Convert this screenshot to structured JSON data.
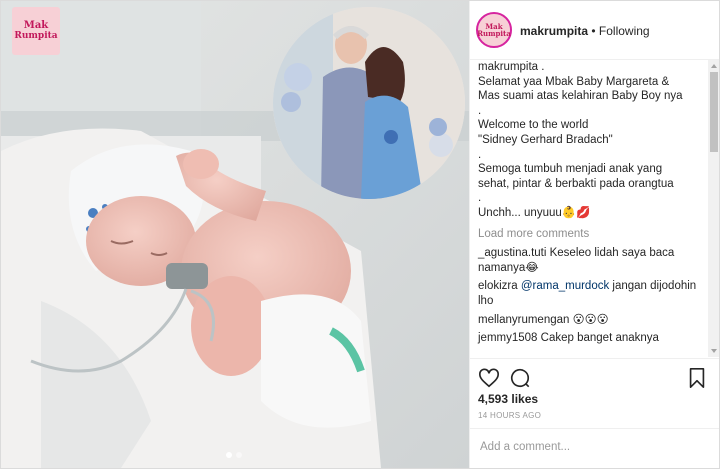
{
  "logo": {
    "line1": "Mak",
    "line2": "Rumpita"
  },
  "header": {
    "avatar": {
      "line1": "Mak",
      "line2": "Rumpita"
    },
    "username": "makrumpita",
    "separator": " • ",
    "follow_status": "Following"
  },
  "caption": {
    "username": "makrumpita .",
    "lines": [
      "Selamat yaa Mbak Baby Margareta &",
      "Mas suami atas kelahiran Baby Boy nya",
      ".",
      "Welcome to the world",
      "\"Sidney Gerhard Bradach\"",
      ".",
      "Semoga tumbuh menjadi anak yang",
      "sehat, pintar & berbakti pada orangtua",
      ".",
      "Unchh... unyuuu👶💋"
    ]
  },
  "load_more": "Load more comments",
  "comments": [
    {
      "user": "_agustina.tuti",
      "text": " Keseleo lidah saya baca namanya😂"
    },
    {
      "user": "elokizra",
      "mention": "@rama_murdock",
      "text": " jangan dijodohin lho"
    },
    {
      "user": "mellanyrumengan",
      "text": " 😮😮😮"
    },
    {
      "user": "jemmy1508",
      "text": " Cakep banget anaknya"
    }
  ],
  "likes": "4,593 likes",
  "timestamp": "14 HOURS AGO",
  "comment_input": {
    "placeholder": "Add a comment..."
  },
  "icons": [
    "heart-icon",
    "comment-icon",
    "bookmark-icon"
  ],
  "colors": {
    "mention": "#003569",
    "muted": "#8e8e8e",
    "logo_bg": "#f7d0d6",
    "logo_text": "#c2185b"
  }
}
